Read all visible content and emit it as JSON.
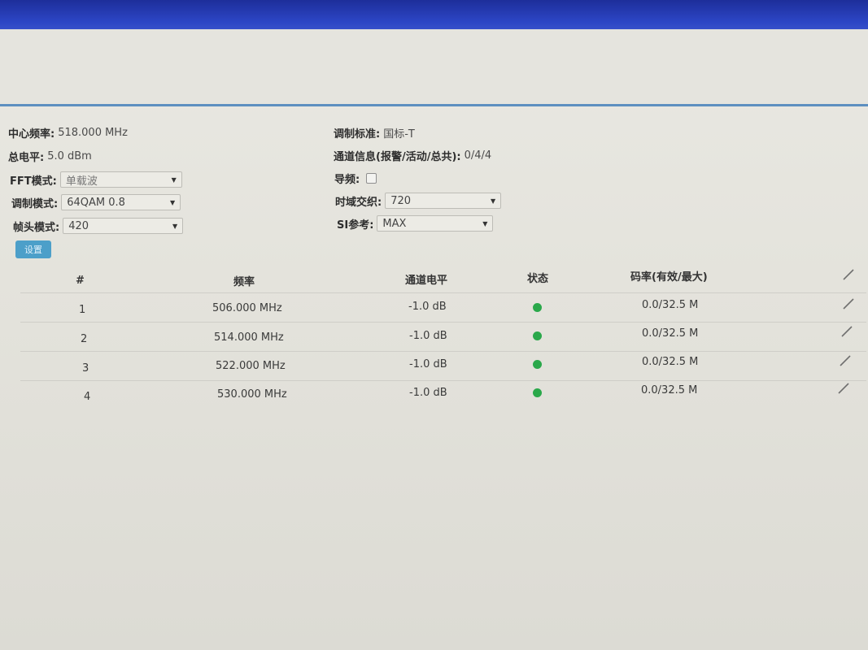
{
  "info": {
    "center_freq_label": "中心频率:",
    "center_freq_value": "518.000 MHz",
    "total_level_label": "总电平:",
    "total_level_value": "5.0 dBm",
    "fft_label": "FFT模式:",
    "fft_value": "单载波",
    "modulation_label": "调制模式:",
    "modulation_value": "64QAM 0.8",
    "frame_header_label": "帧头模式:",
    "frame_header_value": "420",
    "standard_label": "调制标准:",
    "standard_value": "国标-T",
    "channel_info_label": "通道信息(报警/活动/总共):",
    "channel_info_value": "0/4/4",
    "pilot_label": "导频:",
    "pilot_checked": false,
    "interleave_label": "时域交织:",
    "interleave_value": "720",
    "si_label": "SI参考:",
    "si_value": "MAX"
  },
  "set_button_label": "设置",
  "table": {
    "headers": [
      "#",
      "频率",
      "通道电平",
      "状态",
      "码率(有效/最大)"
    ],
    "rows": [
      {
        "index": "1",
        "frequency": "506.000 MHz",
        "level": "-1.0 dB",
        "status": "green",
        "bitrate": "0.0/32.5 M"
      },
      {
        "index": "2",
        "frequency": "514.000 MHz",
        "level": "-1.0 dB",
        "status": "green",
        "bitrate": "0.0/32.5 M"
      },
      {
        "index": "3",
        "frequency": "522.000 MHz",
        "level": "-1.0 dB",
        "status": "green",
        "bitrate": "0.0/32.5 M"
      },
      {
        "index": "4",
        "frequency": "530.000 MHz",
        "level": "-1.0 dB",
        "status": "green",
        "bitrate": "0.0/32.5 M"
      }
    ]
  },
  "colors": {
    "accent_line": "#5d8fc0",
    "status_ok": "#2aa84a",
    "button_bg": "#4c9fc9"
  },
  "icons": {
    "edit": "pencil-icon",
    "status": "status-dot-icon"
  }
}
